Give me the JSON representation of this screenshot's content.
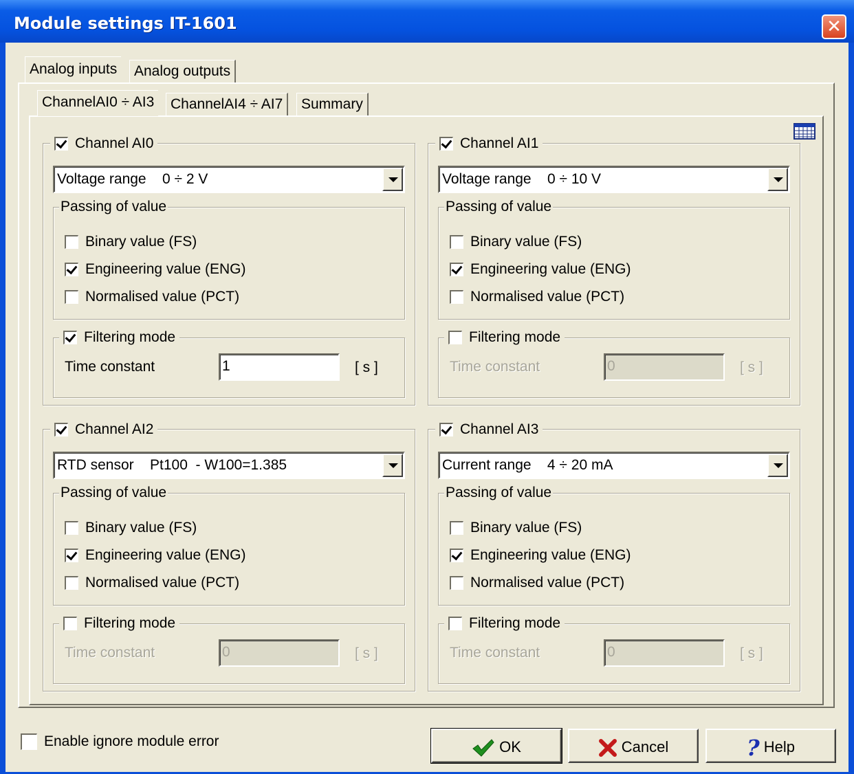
{
  "window": {
    "title": "Module settings IT-1601"
  },
  "outer_tabs": [
    "Analog inputs",
    "Analog outputs"
  ],
  "inner_tabs": [
    "ChannelAI0 ÷ AI3",
    "ChannelAI4 ÷ AI7",
    "Summary"
  ],
  "channels": [
    {
      "name": "Channel AI0",
      "enabled": true,
      "range_type": "Voltage range",
      "range_value": "0 ÷ 2 V",
      "passing_label": "Passing of value",
      "binary_label": "Binary value (FS)",
      "binary": false,
      "eng_label": "Engineering value (ENG)",
      "eng": true,
      "pct_label": "Normalised value (PCT)",
      "pct": false,
      "filter_label": "Filtering mode",
      "filter": true,
      "time_label": "Time constant",
      "time_value": "1",
      "unit": "[ s ]"
    },
    {
      "name": "Channel AI1",
      "enabled": true,
      "range_type": "Voltage range",
      "range_value": "0 ÷ 10 V",
      "passing_label": "Passing of value",
      "binary_label": "Binary value (FS)",
      "binary": false,
      "eng_label": "Engineering value (ENG)",
      "eng": true,
      "pct_label": "Normalised value (PCT)",
      "pct": false,
      "filter_label": "Filtering mode",
      "filter": false,
      "time_label": "Time constant",
      "time_value": "0",
      "unit": "[ s ]"
    },
    {
      "name": "Channel AI2",
      "enabled": true,
      "range_type": "RTD sensor",
      "range_value": "Pt100  - W100=1.385",
      "passing_label": "Passing of value",
      "binary_label": "Binary value (FS)",
      "binary": false,
      "eng_label": "Engineering value (ENG)",
      "eng": true,
      "pct_label": "Normalised value (PCT)",
      "pct": false,
      "filter_label": "Filtering mode",
      "filter": false,
      "time_label": "Time constant",
      "time_value": "0",
      "unit": "[ s ]"
    },
    {
      "name": "Channel AI3",
      "enabled": true,
      "range_type": "Current range",
      "range_value": "4 ÷ 20 mA",
      "passing_label": "Passing of value",
      "binary_label": "Binary value (FS)",
      "binary": false,
      "eng_label": "Engineering value (ENG)",
      "eng": true,
      "pct_label": "Normalised value (PCT)",
      "pct": false,
      "filter_label": "Filtering mode",
      "filter": false,
      "time_label": "Time constant",
      "time_value": "0",
      "unit": "[ s ]"
    }
  ],
  "footer": {
    "ignore_error_label": "Enable ignore module error",
    "ignore_error": false,
    "ok_label": "OK",
    "cancel_label": "Cancel",
    "help_label": "Help"
  }
}
